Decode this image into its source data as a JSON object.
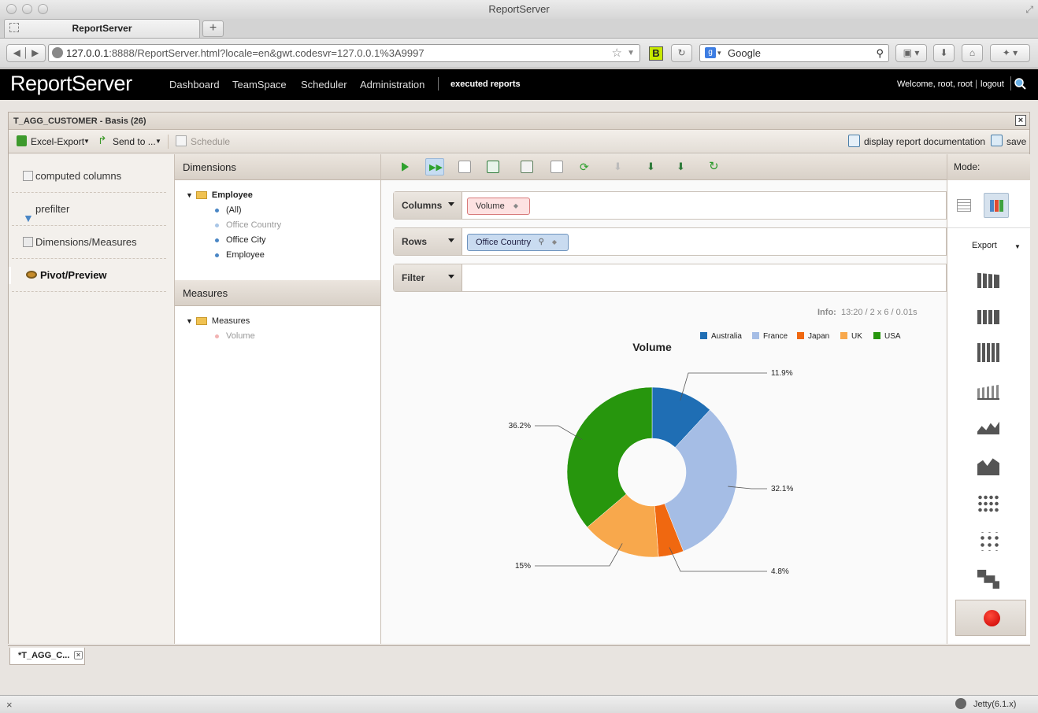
{
  "browser": {
    "window_title": "ReportServer",
    "tab_title": "ReportServer",
    "url_host": "127.0.0.1",
    "url_rest": ":8888/ReportServer.html?locale=en&gwt.codesvr=127.0.0.1%3A9997",
    "search_engine": "Google",
    "bookmark_badge": "B"
  },
  "app": {
    "logo": "ReportServer",
    "nav": [
      "Dashboard",
      "TeamSpace",
      "Scheduler",
      "Administration"
    ],
    "executed_reports": "executed reports",
    "welcome": "Welcome, root, root",
    "logout": "logout"
  },
  "report": {
    "title": "T_AGG_CUSTOMER - Basis (26)",
    "toolbar": {
      "excel_export": "Excel-Export",
      "send_to": "Send to ...",
      "schedule": "Schedule",
      "documentation": "display report documentation",
      "save": "save"
    },
    "sidebar": [
      "computed columns",
      "prefilter",
      "Dimensions/Measures",
      "Pivot/Preview"
    ],
    "dimensions": {
      "header": "Dimensions",
      "root": "Employee",
      "items": [
        "(All)",
        "Office Country",
        "Office City",
        "Employee"
      ]
    },
    "measures": {
      "header": "Measures",
      "root": "Measures",
      "items": [
        "Volume"
      ]
    },
    "pivot": {
      "columns_label": "Columns",
      "rows_label": "Rows",
      "filter_label": "Filter",
      "columns_chip": "Volume",
      "rows_chip": "Office Country",
      "info_label": "Info:",
      "info_value": "13:20  /  2 x 6  /  0.01s"
    },
    "mode": {
      "header": "Mode:",
      "export": "Export"
    },
    "bottom_tab": "*T_AGG_C..."
  },
  "status": {
    "close": "×",
    "server": "Jetty(6.1.x)"
  },
  "colors": {
    "Australia": "#1f6eb4",
    "France": "#a5bde5",
    "Japan": "#f06810",
    "UK": "#f8a84c",
    "USA": "#27960d"
  },
  "chart_data": {
    "type": "pie",
    "title": "Volume",
    "donut": true,
    "legend_position": "top-right",
    "categories": [
      "Australia",
      "France",
      "Japan",
      "UK",
      "USA"
    ],
    "values": [
      11.9,
      32.1,
      4.8,
      15,
      36.2
    ],
    "labels": [
      "11.9%",
      "32.1%",
      "4.8%",
      "15%",
      "36.2%"
    ]
  }
}
